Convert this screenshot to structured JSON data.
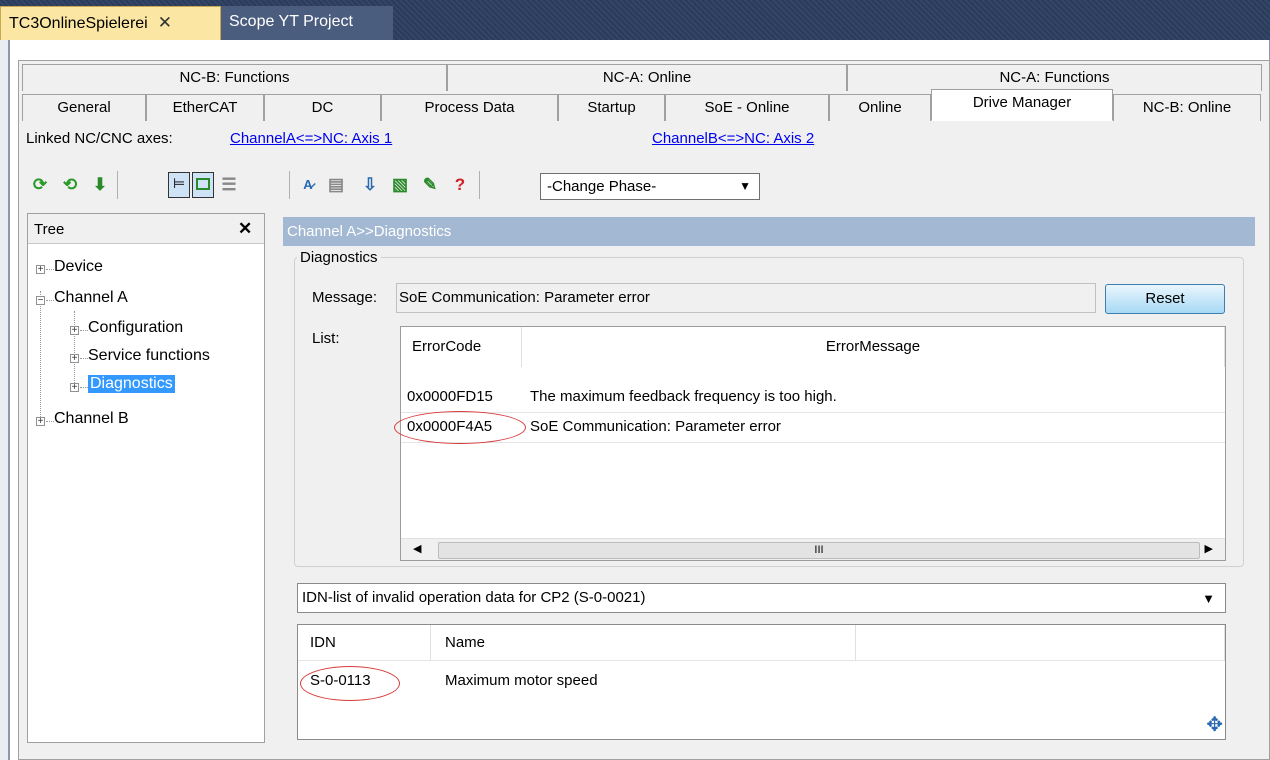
{
  "doc_tabs": [
    {
      "label": "TC3OnlineSpielerei",
      "close": "✕"
    },
    {
      "label": "Scope YT Project"
    }
  ],
  "prop_tabs_row1": [
    "NC-B: Functions",
    "NC-A: Online",
    "NC-A: Functions"
  ],
  "prop_tabs_row2": [
    "General",
    "EtherCAT",
    "DC",
    "Process Data",
    "Startup",
    "SoE - Online",
    "Online",
    "Drive Manager",
    "NC-B: Online"
  ],
  "active_tab": "Drive Manager",
  "linked": {
    "label": "Linked NC/CNC axes:",
    "channel_a": "ChannelA<=>NC: Axis 1",
    "channel_b": "ChannelB<=>NC: Axis 2"
  },
  "toolbar": {
    "phase_select": "-Change Phase-",
    "help": "?",
    "icons": [
      "refresh-green-icon",
      "refresh-icon",
      "download-icon",
      "tree-view-icon",
      "split-view-icon",
      "list-view-icon",
      "translate-icon",
      "grid-icon",
      "import-icon",
      "chart-icon",
      "tools-icon",
      "help-icon"
    ]
  },
  "tree": {
    "title": "Tree",
    "close": "✕",
    "nodes": [
      "Device",
      "Channel A",
      "Configuration",
      "Service functions",
      "Diagnostics",
      "Channel B"
    ],
    "selected": "Diagnostics"
  },
  "right": {
    "header": "Channel A>>Diagnostics",
    "group_title": "Diagnostics",
    "message_label": "Message:",
    "message": "SoE Communication: Parameter error",
    "reset": "Reset",
    "list_label": "List:",
    "error_columns": [
      "ErrorCode",
      "ErrorMessage"
    ],
    "errors": [
      {
        "code": "0x0000FD15",
        "message": "The maximum feedback frequency is too high."
      },
      {
        "code": "0x0000F4A5",
        "message": "SoE Communication: Parameter error"
      }
    ],
    "scroll_mark": "III",
    "idn_select": "IDN-list of invalid operation data for CP2 (S-0-0021)",
    "idn_columns": [
      "IDN",
      "Name"
    ],
    "idn_rows": [
      {
        "idn": "S-0-0113",
        "name": "Maximum motor speed"
      }
    ]
  },
  "colors": {
    "accent": "#3399ff",
    "highlight_ring": "#d93b3b",
    "header_bar": "#a3b8d2"
  }
}
